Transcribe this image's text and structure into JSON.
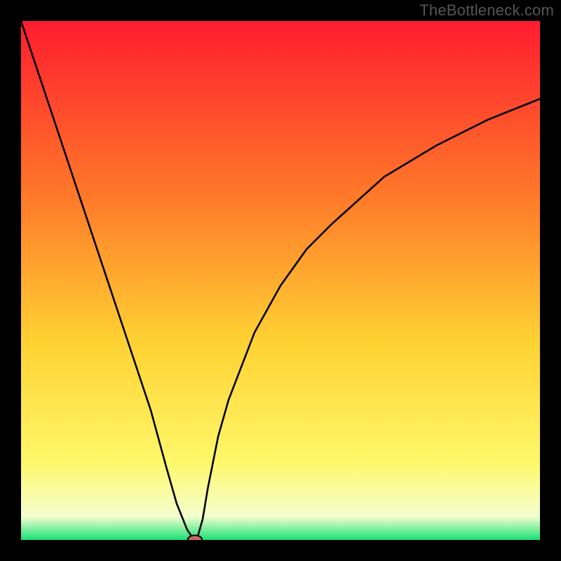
{
  "watermark": "TheBottleneck.com",
  "colors": {
    "border": "#000000",
    "curve": "#000000",
    "marker_fill": "#c26b5e",
    "marker_stroke": "#000000",
    "gradient": {
      "top": "#ff1c2f",
      "mid_upper": "#ff7a2a",
      "mid": "#ffd233",
      "mid_lower": "#fff86a",
      "near_bottom": "#f4ffcf",
      "bottom": "#19e074"
    }
  },
  "chart_data": {
    "type": "line",
    "title": "",
    "xlabel": "",
    "ylabel": "",
    "x": [
      0,
      5,
      10,
      15,
      20,
      25,
      28,
      30,
      32,
      33,
      33.5,
      34,
      35,
      36,
      38,
      40,
      45,
      50,
      55,
      60,
      70,
      80,
      90,
      100
    ],
    "values": [
      100,
      85,
      70,
      55,
      40,
      25,
      14,
      7,
      2,
      0.5,
      0,
      0.5,
      4,
      10,
      20,
      27,
      40,
      49,
      56,
      61,
      70,
      76,
      81,
      85
    ],
    "xlim": [
      0,
      100
    ],
    "ylim": [
      0,
      100
    ],
    "marker": {
      "x": 33.5,
      "y": 0,
      "rx": 1.4,
      "ry": 0.9
    },
    "note": "Values are percentages read off the vertical gradient scale (0 = green bottom, 100 = red top). Curve is a V-shaped dip reaching the bottom near x≈33.5 with a small marker at the minimum."
  }
}
